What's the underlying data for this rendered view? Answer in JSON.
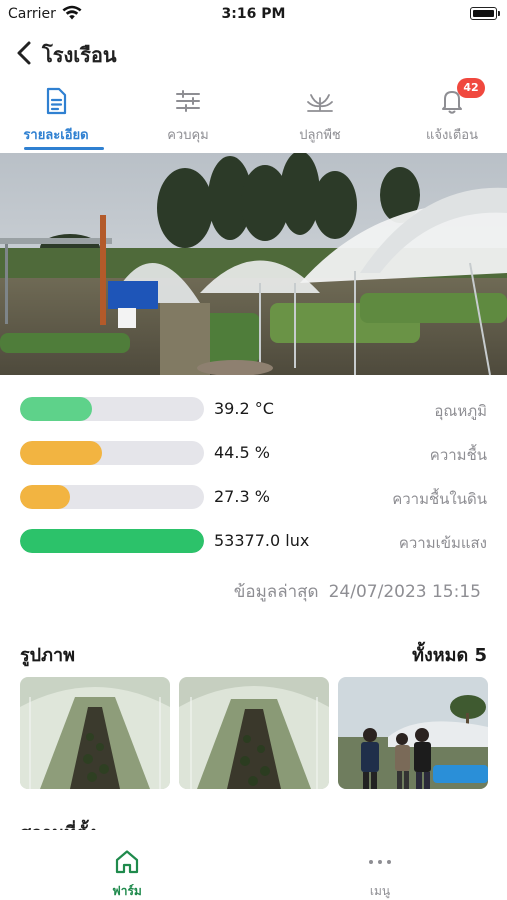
{
  "status": {
    "carrier": "Carrier",
    "time": "3:16 PM"
  },
  "header": {
    "title": "โรงเรือน"
  },
  "tabs": [
    {
      "label": "รายละเอียด",
      "active": true
    },
    {
      "label": "ควบคุม"
    },
    {
      "label": "ปลูกพืช"
    },
    {
      "label": "แจ้งเตือน",
      "badge": "42"
    }
  ],
  "sensors": [
    {
      "value": "39.2 °C",
      "label": "อุณหภูมิ",
      "level": 0.39,
      "color": "#5ed28a"
    },
    {
      "value": "44.5 %",
      "label": "ความชื้น",
      "level": 0.445,
      "color": "#f2b441"
    },
    {
      "value": "27.3 %",
      "label": "ความชื้นในดิน",
      "level": 0.273,
      "color": "#f2b441"
    },
    {
      "value": "53377.0 lux",
      "label": "ความเข้มแสง",
      "level": 1.0,
      "color": "#2cc26a"
    }
  ],
  "updated": {
    "label": "ข้อมูลล่าสุด",
    "datetime": "24/07/2023 15:15"
  },
  "gallery": {
    "title": "รูปภาพ",
    "count_label": "ทั้งหมด 5"
  },
  "partial_section": {
    "title": "สถานที่ตั้ง"
  },
  "bottom_nav": [
    {
      "label": "ฟาร์ม",
      "active": true
    },
    {
      "label": "เมนู"
    }
  ],
  "colors": {
    "accent": "#2f80d1",
    "farm_green": "#1f8a4c",
    "badge_red": "#f0483e"
  }
}
